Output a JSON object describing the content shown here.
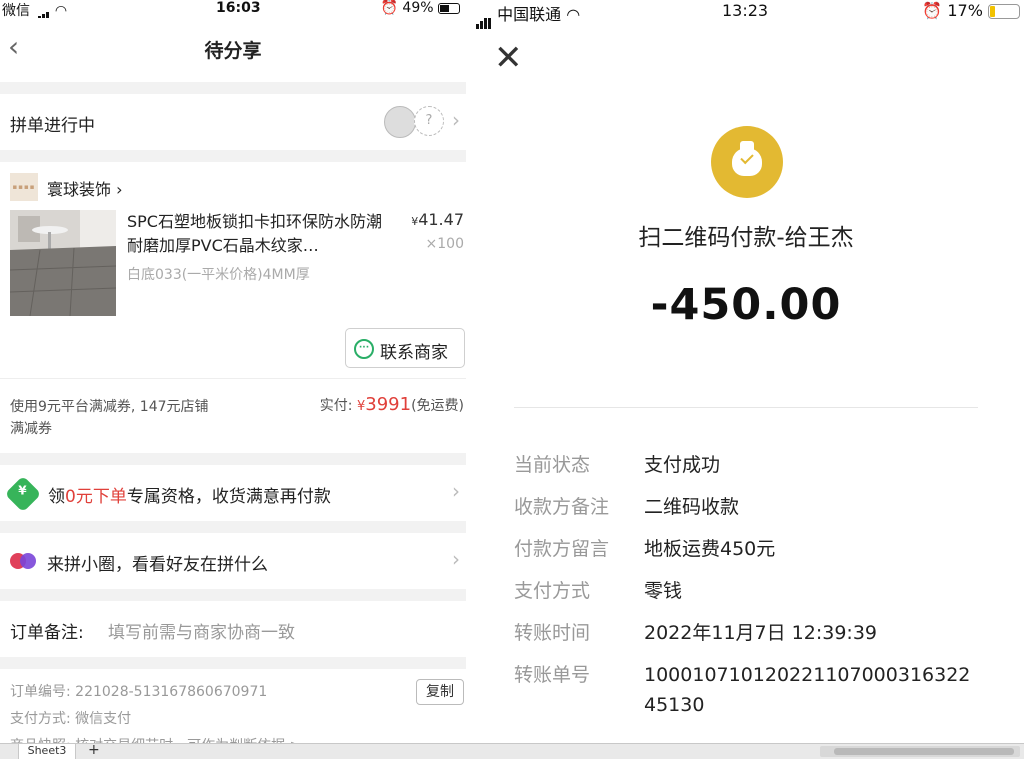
{
  "left_panel": {
    "status_bar": {
      "carrier": "微信",
      "time": "16:03",
      "battery": "49%"
    },
    "nav": {
      "back_icon": "chevron-left-icon",
      "title": "待分享"
    },
    "group_section": {
      "title": "拼单进行中",
      "placeholder_avatar_text": "?"
    },
    "product_section": {
      "shop_name": "寰球装饰",
      "shop_chevron": "›",
      "product_name": "SPC石塑地板锁扣卡扣环保防水防潮耐磨加厚PVC石晶木纹家…",
      "product_spec": "白底033(一平米价格)4MM厚",
      "price_symbol": "¥",
      "price": "41.47",
      "quantity": "×100",
      "contact_label": "联系商家",
      "coupon_text": "使用9元平台满减券, 147元店铺满减券",
      "paid_label": "实付:",
      "paid_symbol": "¥",
      "paid_amount": "3991",
      "paid_note": "(免运费)"
    },
    "free_section": {
      "text_prefix": "领",
      "text_red": "0元下单",
      "text_suffix": "专属资格，收货满意再付款"
    },
    "circle_section": {
      "text": "来拼小圈，看看好友在拼什么"
    },
    "remark_section": {
      "label": "订单备注:",
      "placeholder": "填写前需与商家协商一致"
    },
    "order_section": {
      "order_no": "订单编号:  221028-513167860670971",
      "pay_method": "支付方式:  微信支付",
      "snapshot": "商品快照:  核对交易细节时，可作为判断依据 >",
      "copy_label": "复制"
    }
  },
  "right_panel": {
    "status_bar": {
      "carrier": "中国联通",
      "time": "13:23",
      "battery": "17%"
    },
    "close_icon": "close-icon",
    "pay_title": "扫二维码付款-给王杰",
    "amount": "-450.00",
    "details": [
      {
        "key": "当前状态",
        "value": "支付成功"
      },
      {
        "key": "收款方备注",
        "value": "二维码收款"
      },
      {
        "key": "付款方留言",
        "value": "地板运费450元"
      },
      {
        "key": "支付方式",
        "value": "零钱"
      },
      {
        "key": "转账时间",
        "value": "2022年11月7日 12:39:39"
      },
      {
        "key": "转账单号",
        "value": "100010710120221107000316322 45130"
      }
    ]
  },
  "bottom_bar": {
    "sheet_tab": "Sheet3",
    "add_icon": "+"
  },
  "colors": {
    "price_red": "#e0403a",
    "wechat_green": "#2aae67",
    "pay_gold": "#e3b932",
    "promo_green": "#37b45a"
  }
}
